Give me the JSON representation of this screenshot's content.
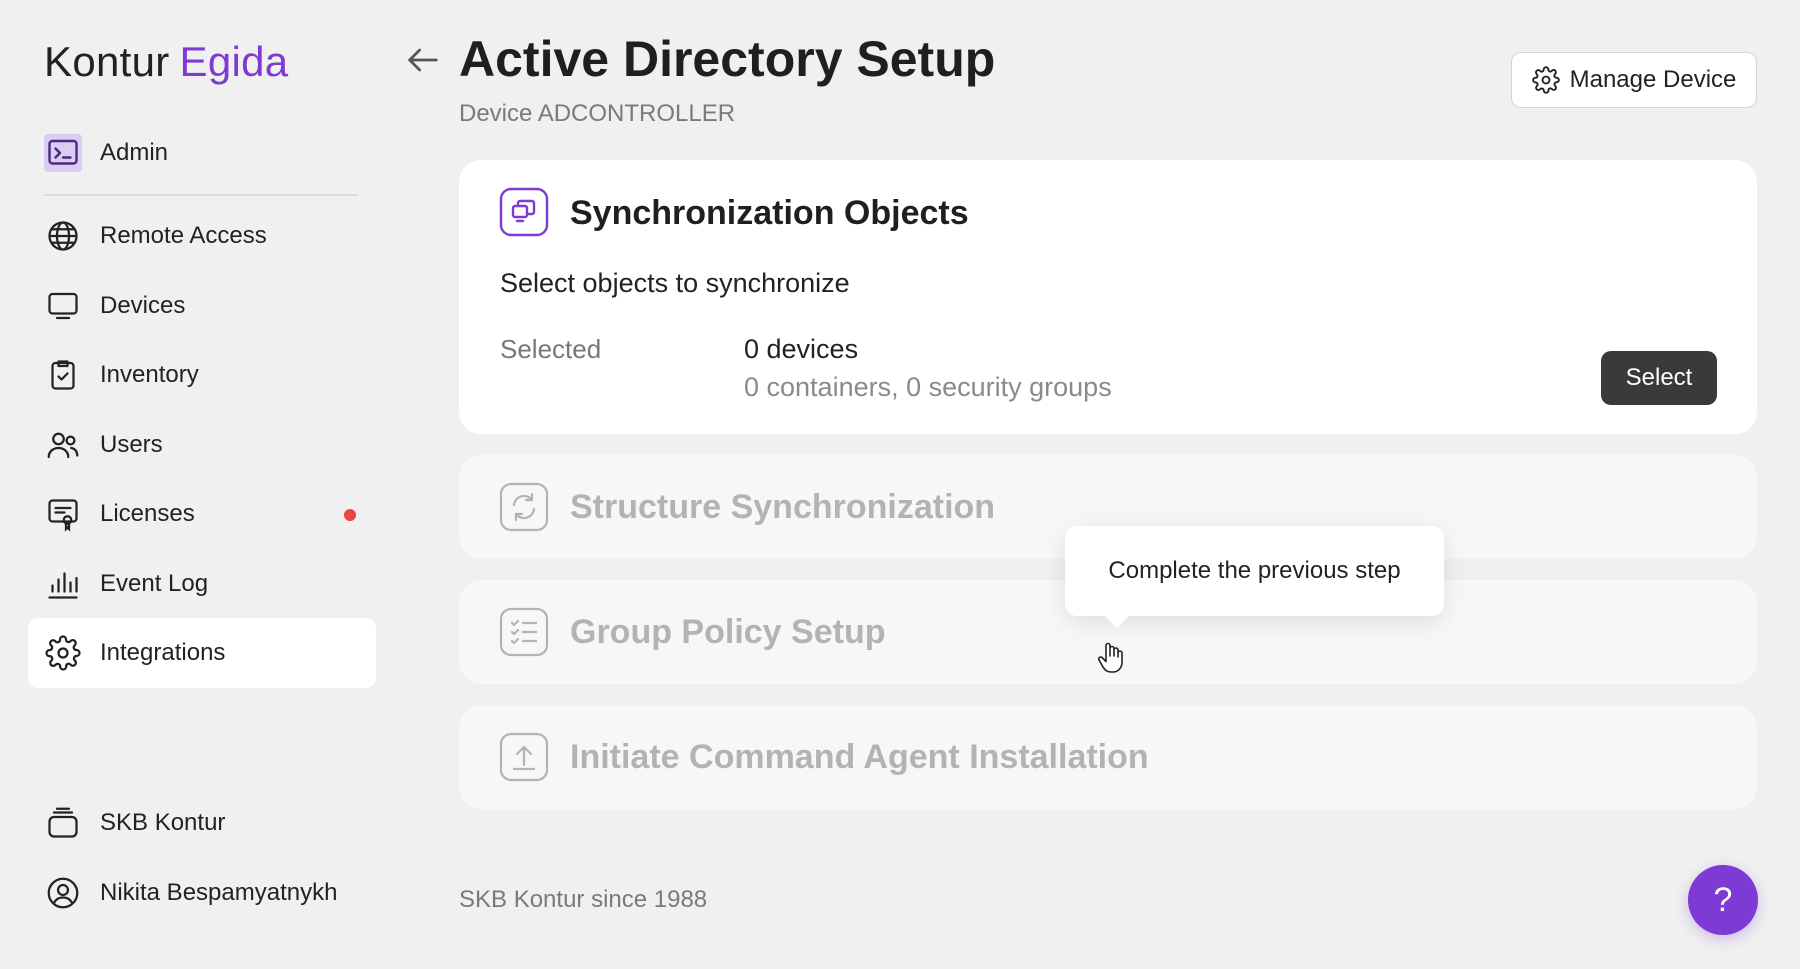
{
  "brand": {
    "name_part1": "Kontur",
    "name_part2": "Egida"
  },
  "sidebar": {
    "admin": {
      "label": "Admin",
      "icon": "terminal-icon"
    },
    "items": [
      {
        "label": "Remote Access",
        "icon": "globe-icon"
      },
      {
        "label": "Devices",
        "icon": "monitor-icon"
      },
      {
        "label": "Inventory",
        "icon": "clipboard-check-icon"
      },
      {
        "label": "Users",
        "icon": "users-icon"
      },
      {
        "label": "Licenses",
        "icon": "license-icon",
        "has_notification": true
      },
      {
        "label": "Event Log",
        "icon": "bar-chart-icon"
      },
      {
        "label": "Integrations",
        "icon": "gear-icon",
        "active": true
      }
    ],
    "bottom": [
      {
        "label": "SKB Kontur",
        "icon": "organization-icon"
      },
      {
        "label": "Nikita Bespamyatnykh",
        "icon": "user-circle-icon"
      }
    ]
  },
  "header": {
    "title": "Active Directory Setup",
    "subtitle": "Device ADCONTROLLER",
    "manage_label": "Manage Device"
  },
  "steps": {
    "sync": {
      "title": "Synchronization Objects",
      "description": "Select objects to synchronize",
      "selected_label": "Selected",
      "selected_value": "0 devices",
      "selected_detail": "0 containers, 0 security groups",
      "select_label": "Select"
    },
    "structure": {
      "title": "Structure Synchronization"
    },
    "policy": {
      "title": "Group Policy Setup"
    },
    "agent": {
      "title": "Initiate Command Agent Installation"
    }
  },
  "tooltip": {
    "text": "Complete the previous step"
  },
  "footer": {
    "text": "SKB Kontur since 1988"
  },
  "help": {
    "label": "?"
  },
  "colors": {
    "accent": "#7e3bd4",
    "notification": "#e84545",
    "button_dark": "#3a3a3a"
  }
}
